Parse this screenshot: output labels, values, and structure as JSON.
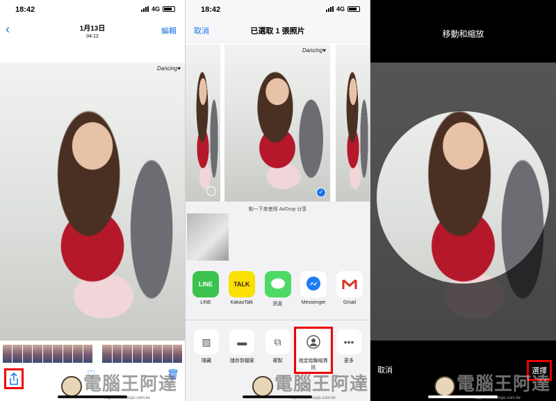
{
  "status": {
    "time": "18:42",
    "network": "4G"
  },
  "photos_view": {
    "back_icon": "chevron-left-icon",
    "date": "1月13日",
    "time": "04:12",
    "edit_label": "編輯",
    "watermark": "Dancing♥",
    "toolbar_icons": [
      "share-icon",
      "heart-icon",
      "trash-icon"
    ]
  },
  "share_sheet": {
    "cancel_label": "取消",
    "title": "已選取 1 張照片",
    "airdrop_hint": "點一下來使用 AirDrop 分享",
    "apps": [
      {
        "label": "LINE",
        "icon_text": "LINE",
        "color": "#3bc34d"
      },
      {
        "label": "KakaoTalk",
        "icon_text": "TALK",
        "color": "#f9e000"
      },
      {
        "label": "訊息",
        "icon_text": "",
        "color": "#4cd964"
      },
      {
        "label": "Messenger",
        "icon_text": "",
        "color": "#ffffff"
      },
      {
        "label": "Gmail",
        "icon_text": "",
        "color": "#ffffff"
      }
    ],
    "actions": [
      {
        "label": "隱藏",
        "icon": "hide-icon"
      },
      {
        "label": "儲存到檔案",
        "icon": "folder-icon"
      },
      {
        "label": "複製",
        "icon": "copy-icon"
      },
      {
        "label": "指定給聯絡資訊",
        "icon": "contact-icon"
      },
      {
        "label": "更多",
        "icon": "more-icon"
      }
    ]
  },
  "crop_view": {
    "title": "移動和縮放",
    "cancel_label": "取消",
    "select_label": "選擇"
  },
  "branding": {
    "name": "電腦王阿達",
    "url": "http://www.kocpc.com.tw"
  }
}
